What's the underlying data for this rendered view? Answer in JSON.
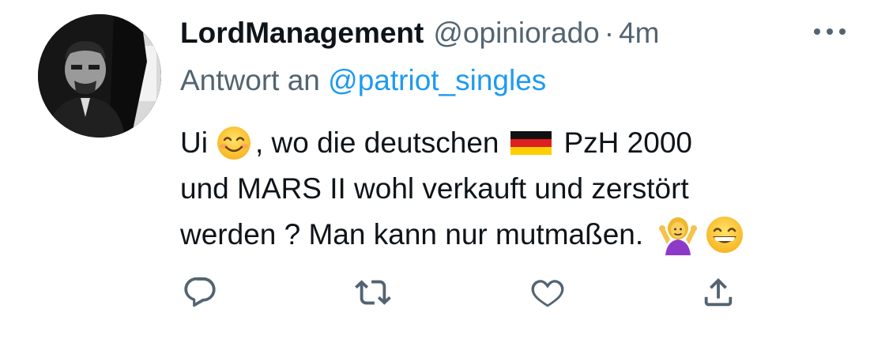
{
  "tweet": {
    "display_name": "LordManagement",
    "handle": "@opiniorado",
    "separator": "·",
    "time": "4m",
    "reply_prefix": "Antwort an",
    "reply_to": "@patriot_singles",
    "text": {
      "line1_part1": "Ui",
      "line1_part2": ", wo die deutschen",
      "line1_part3": "PzH 2000",
      "line2": "und MARS II wohl verkauft und zerstört",
      "line3": "werden ? Man kann nur mutmaßen."
    },
    "emojis": [
      "smiling-face-emoji",
      "germany-flag-emoji",
      "person-shrugging-emoji",
      "grinning-face-emoji"
    ]
  },
  "actions": {
    "icons": [
      "reply-icon",
      "retweet-icon",
      "like-icon",
      "share-icon"
    ]
  },
  "colors": {
    "text_primary": "#0f1419",
    "text_secondary": "#536471",
    "link": "#1d9bf0",
    "background": "#ffffff"
  }
}
